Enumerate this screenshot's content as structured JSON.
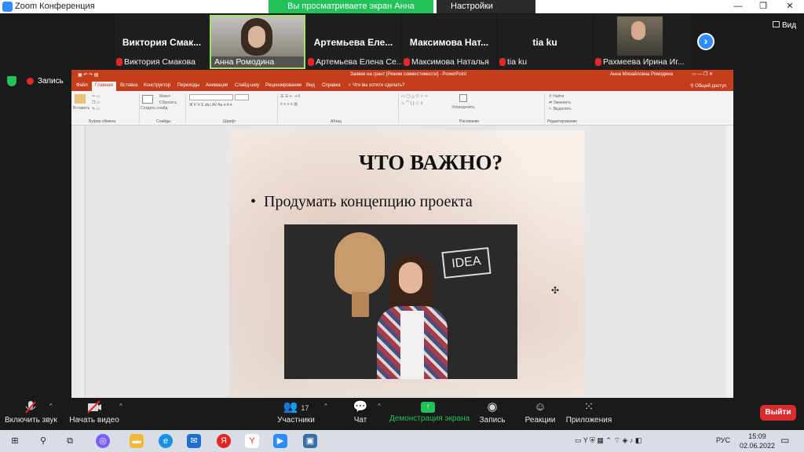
{
  "window": {
    "title": "Zoom Конференция",
    "share_banner": "Вы просматриваете экран Анна Ромодина",
    "view_options": "Настройки просмотра"
  },
  "gallery": {
    "tiles": [
      {
        "big": "Виктория  Смак...",
        "name": "Виктория Смакова"
      },
      {
        "big": "",
        "name": "Анна Ромодина"
      },
      {
        "big": "Артемьева  Еле...",
        "name": "Артемьева Елена Се..."
      },
      {
        "big": "Максимова  Нат...",
        "name": "Максимова Наталья"
      },
      {
        "big": "tia ku",
        "name": "tia ku"
      },
      {
        "big": "",
        "name": "Рахмеева Ирина Иг..."
      }
    ],
    "view_label": "Вид"
  },
  "recording": {
    "label": "Запись"
  },
  "powerpoint": {
    "doc_title": "Заявки на грант [Режим совместимости]  -  PowerPoint",
    "user": "Анна Михайловна Ромодина",
    "tabs": [
      "Файл",
      "Главная",
      "Вставка",
      "Конструктор",
      "Переходы",
      "Анимация",
      "Слайд-шоу",
      "Рецензирование",
      "Вид",
      "Справка"
    ],
    "tell_me": "Что вы хотите сделать?",
    "share": "Общий доступ",
    "groups": [
      "Буфер обмена",
      "Слайды",
      "Шрифт",
      "Абзац",
      "Рисование",
      "Редактирование"
    ],
    "tools": {
      "paste": "Вставить",
      "new_slide": "Создать слайд",
      "layout": "Макет",
      "reset": "Сбросить",
      "arrange": "Упорядочить",
      "find": "Найти",
      "replace": "Заменить",
      "select": "Выделить"
    },
    "slide": {
      "title": "ЧТО ВАЖНО?",
      "bullet": "Продумать концепцию проекта",
      "image_text": "IDEA"
    }
  },
  "toolbar": {
    "mute": "Включить звук",
    "video": "Начать видео",
    "participants": "Участники",
    "participants_count": "17",
    "chat": "Чат",
    "share": "Демонстрация экрана",
    "record": "Запись",
    "reactions": "Реакции",
    "apps": "Приложения",
    "exit": "Выйти"
  },
  "taskbar": {
    "lang": "РУС",
    "time": "15:09",
    "date": "02.06.2022"
  }
}
